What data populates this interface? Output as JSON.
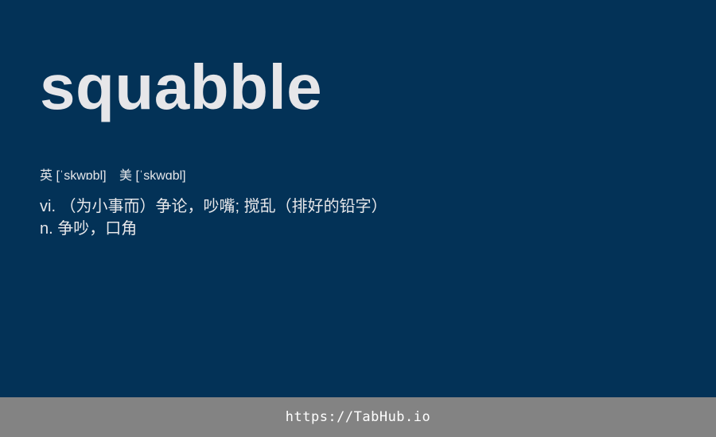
{
  "entry": {
    "word": "squabble",
    "phonetics": {
      "uk": "英 [ˈskwɒbl]",
      "us": "美 [ˈskwɑbl]"
    },
    "definitions": [
      "vi. （为小事而）争论，吵嘴; 搅乱（排好的铅字）",
      "n. 争吵，口角"
    ]
  },
  "footer": {
    "url": "https://TabHub.io"
  }
}
